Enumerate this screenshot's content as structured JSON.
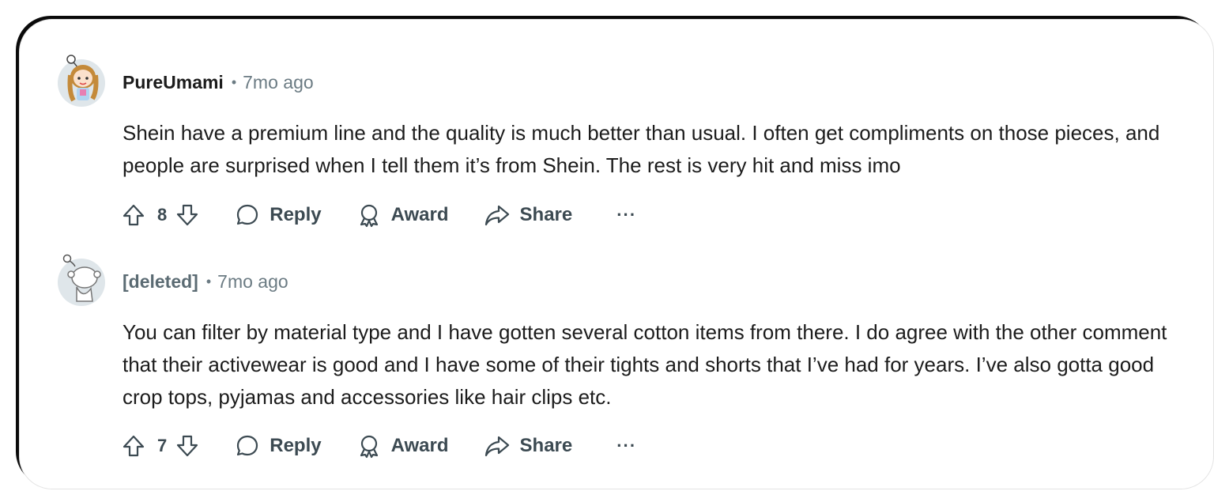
{
  "comments": [
    {
      "username": "PureUmami",
      "separator": "•",
      "time": "7mo ago",
      "body": "Shein have a premium line and the quality is much better than usual. I often get compliments on those pieces, and people are surprised when I tell them it’s from Shein. The rest is very hit and miss imo",
      "votes": "8",
      "reply_label": "Reply",
      "award_label": "Award",
      "share_label": "Share",
      "more_label": "···",
      "avatar_icon": "snoo-avatar-blonde"
    },
    {
      "username": "[deleted]",
      "separator": "•",
      "time": "7mo ago",
      "body": "You can filter by material type and I have gotten several cotton items from there. I do agree with the other comment that their activewear is good and I have some of their tights and shorts that I’ve had for years. I’ve also gotta good crop tops, pyjamas and accessories like hair clips etc.",
      "votes": "7",
      "reply_label": "Reply",
      "award_label": "Award",
      "share_label": "Share",
      "more_label": "···",
      "avatar_icon": "snoo-avatar-default"
    }
  ],
  "colors": {
    "text": "#1c1c1c",
    "meta": "#6b7b83",
    "action": "#3c4a52",
    "deleted_user": "#5b6b73"
  }
}
